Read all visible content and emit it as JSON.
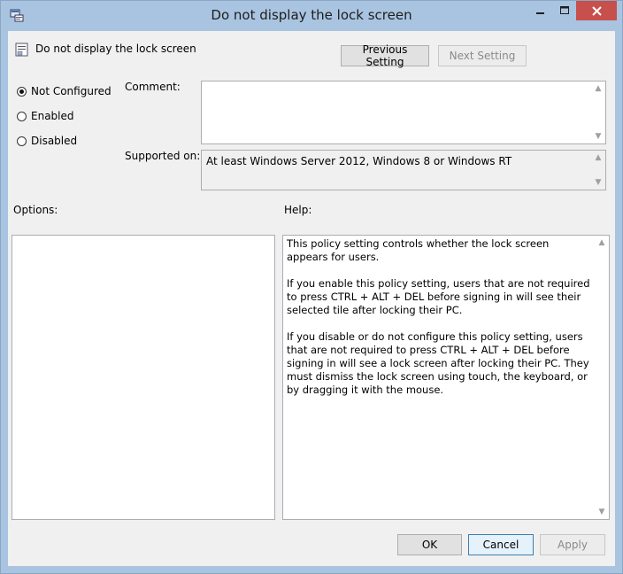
{
  "window": {
    "title": "Do not display the lock screen"
  },
  "policy": {
    "name": "Do not display the lock screen"
  },
  "nav": {
    "previous": "Previous Setting",
    "next": "Next Setting"
  },
  "state": {
    "options": [
      {
        "label": "Not Configured",
        "checked": true
      },
      {
        "label": "Enabled",
        "checked": false
      },
      {
        "label": "Disabled",
        "checked": false
      }
    ]
  },
  "comment": {
    "label": "Comment:",
    "value": ""
  },
  "supported": {
    "label": "Supported on:",
    "value": "At least Windows Server 2012, Windows 8 or Windows RT"
  },
  "options_panel": {
    "label": "Options:"
  },
  "help": {
    "label": "Help:",
    "text": "This policy setting controls whether the lock screen appears for users.\n\nIf you enable this policy setting, users that are not required to press CTRL + ALT + DEL before signing in will see their selected tile after  locking their PC.\n\nIf you disable or do not configure this policy setting, users that are not required to press CTRL + ALT + DEL before signing in will see a lock screen after locking their PC. They must dismiss the lock screen using touch, the keyboard, or by dragging it with the mouse."
  },
  "footer": {
    "ok": "OK",
    "cancel": "Cancel",
    "apply": "Apply"
  },
  "icons": {
    "app": "group-policy-icon",
    "policy": "policy-setting-icon",
    "minimize": "minimize-icon",
    "maximize": "maximize-icon",
    "close": "close-icon"
  },
  "colors": {
    "titlebar": "#a9c4e0",
    "close": "#c7504c",
    "client": "#f0f0f0"
  }
}
